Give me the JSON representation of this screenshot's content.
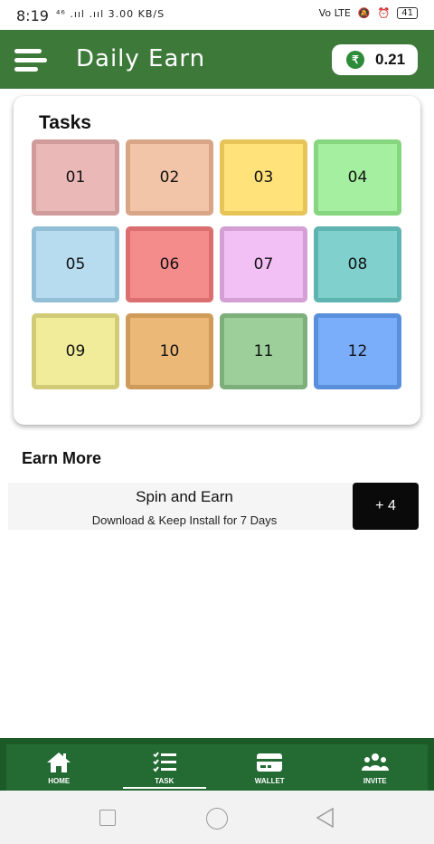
{
  "status_bar": {
    "time": "8:19",
    "signal_text": "⁴⁶ .ııl .ııl 3.00 KB/S",
    "volte": "Vo LTE",
    "battery": "41"
  },
  "header": {
    "title": "Daily Earn",
    "balance": "0.21",
    "currency_symbol": "₹",
    "bar_color": "#3d7a3a",
    "menu_icon": "hamburger-menu-icon"
  },
  "tasks": {
    "title": "Tasks",
    "items": [
      {
        "label": "01",
        "fill": "#ebb8b8",
        "border": "#cf9b9b"
      },
      {
        "label": "02",
        "fill": "#f2c4a8",
        "border": "#d8a587"
      },
      {
        "label": "03",
        "fill": "#ffe27a",
        "border": "#e6c458"
      },
      {
        "label": "04",
        "fill": "#a5f0a0",
        "border": "#86d57f"
      },
      {
        "label": "05",
        "fill": "#b7dcf0",
        "border": "#93bfd6"
      },
      {
        "label": "06",
        "fill": "#f58c8c",
        "border": "#db6f6f"
      },
      {
        "label": "07",
        "fill": "#f3c0f5",
        "border": "#d3a0d5"
      },
      {
        "label": "08",
        "fill": "#80d0ce",
        "border": "#5fb3b1"
      },
      {
        "label": "09",
        "fill": "#f1ec99",
        "border": "#d1cb78"
      },
      {
        "label": "10",
        "fill": "#ebb878",
        "border": "#cf9b5a"
      },
      {
        "label": "11",
        "fill": "#9ccf9a",
        "border": "#7caf7a"
      },
      {
        "label": "12",
        "fill": "#7aaefb",
        "border": "#5a8fdc"
      }
    ]
  },
  "earn_more": {
    "title": "Earn More",
    "offer": {
      "title": "Spin and Earn",
      "subtitle": "Download & Keep Install for 7 Days",
      "reward": "+ 4"
    }
  },
  "bottom_nav": {
    "items": [
      {
        "label": "HOME",
        "icon": "home-icon",
        "active": false
      },
      {
        "label": "TASK",
        "icon": "task-list-icon",
        "active": true
      },
      {
        "label": "WALLET",
        "icon": "wallet-icon",
        "active": false
      },
      {
        "label": "INVITE",
        "icon": "invite-users-icon",
        "active": false
      }
    ]
  }
}
